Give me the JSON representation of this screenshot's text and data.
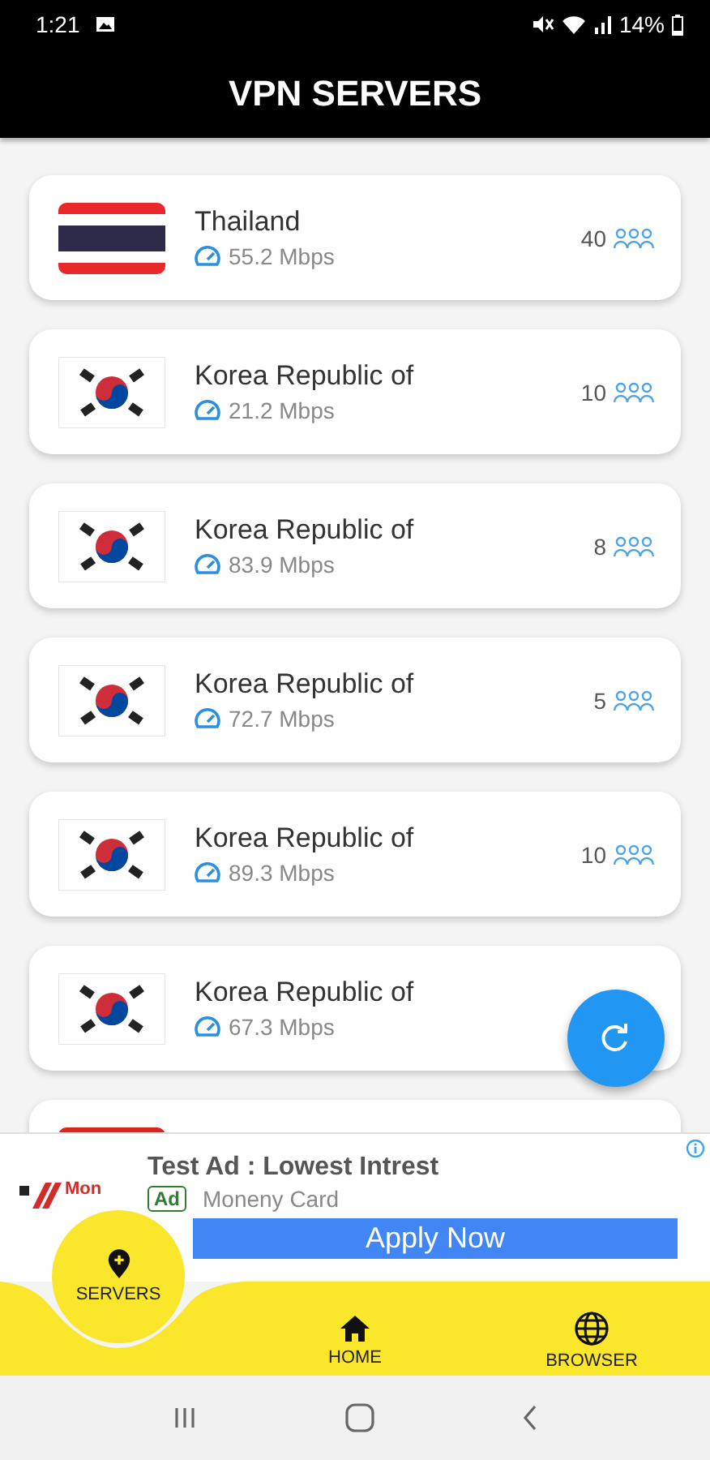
{
  "status_bar": {
    "time": "1:21",
    "battery": "14%"
  },
  "header": {
    "title": "VPN SERVERS"
  },
  "servers": [
    {
      "kind": "thailand",
      "name": "Thailand",
      "speed": "55.2 Mbps",
      "users": "40"
    },
    {
      "kind": "korea",
      "name": "Korea Republic of",
      "speed": "21.2 Mbps",
      "users": "10"
    },
    {
      "kind": "korea",
      "name": "Korea Republic of",
      "speed": "83.9 Mbps",
      "users": "8"
    },
    {
      "kind": "korea",
      "name": "Korea Republic of",
      "speed": "72.7 Mbps",
      "users": "5"
    },
    {
      "kind": "korea",
      "name": "Korea Republic of",
      "speed": "89.3 Mbps",
      "users": "10"
    },
    {
      "kind": "korea",
      "name": "Korea Republic of",
      "speed": "67.3 Mbps"
    },
    {
      "kind": "red"
    }
  ],
  "ad": {
    "logo_text": "Mon",
    "title": "Test Ad : Lowest Intrest",
    "badge": "Ad",
    "advertiser": "Moneny Card",
    "button": "Apply Now"
  },
  "bottom_nav": [
    {
      "kind": "servers",
      "label": "SERVERS",
      "selected": true
    },
    {
      "kind": "home",
      "label": "HOME",
      "selected": false
    },
    {
      "kind": "browser",
      "label": "BROWSER",
      "selected": false
    }
  ]
}
